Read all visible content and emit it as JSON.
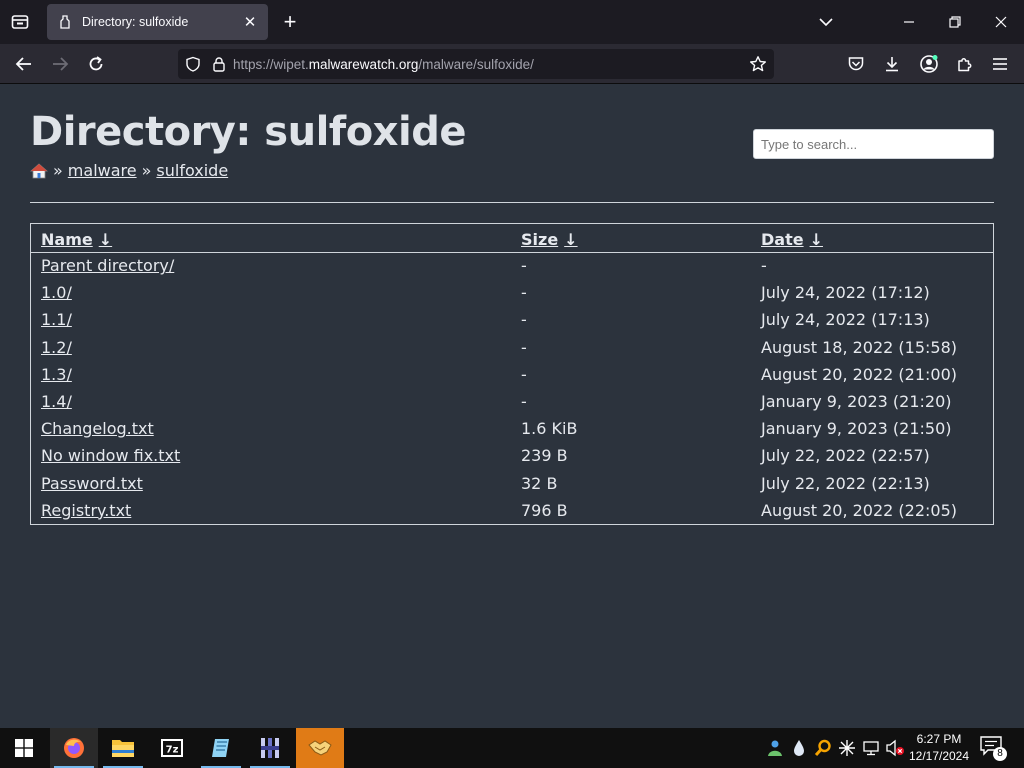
{
  "browser": {
    "tab_title": "Directory: sulfoxide",
    "url_prefix": "https://wipet.",
    "url_host": "malwarewatch.org",
    "url_path": "/malware/sulfoxide/"
  },
  "page": {
    "title": "Directory: sulfoxide",
    "breadcrumb": [
      "malware",
      "sulfoxide"
    ],
    "breadcrumb_sep": "»",
    "search_placeholder": "Type to search...",
    "columns": [
      {
        "label": "Name",
        "arrow": "↓"
      },
      {
        "label": "Size",
        "arrow": "↓"
      },
      {
        "label": "Date",
        "arrow": "↓"
      }
    ],
    "rows": [
      {
        "name": "Parent directory/",
        "size": "-",
        "date": "-"
      },
      {
        "name": "1.0/",
        "size": "-",
        "date": "July 24, 2022 (17:12)"
      },
      {
        "name": "1.1/",
        "size": "-",
        "date": "July 24, 2022 (17:13)"
      },
      {
        "name": "1.2/",
        "size": "-",
        "date": "August 18, 2022 (15:58)"
      },
      {
        "name": "1.3/",
        "size": "-",
        "date": "August 20, 2022 (21:00)"
      },
      {
        "name": "1.4/",
        "size": "-",
        "date": "January 9, 2023 (21:20)"
      },
      {
        "name": "Changelog.txt",
        "size": "1.6 KiB",
        "date": "January 9, 2023 (21:50)"
      },
      {
        "name": "No window fix.txt",
        "size": "239 B",
        "date": "July 22, 2022 (22:57)"
      },
      {
        "name": "Password.txt",
        "size": "32 B",
        "date": "July 22, 2022 (22:13)"
      },
      {
        "name": "Registry.txt",
        "size": "796 B",
        "date": "August 20, 2022 (22:05)"
      }
    ]
  },
  "taskbar": {
    "time": "6:27 PM",
    "date": "12/17/2024",
    "notification_count": "8",
    "apps": [
      "firefox-icon",
      "file-explorer-icon",
      "7zip-icon",
      "notepad-icon",
      "app-icon",
      "handshake-icon"
    ]
  },
  "colors": {
    "page_bg": "#2c333d",
    "chrome_bg": "#1c1b22",
    "taskbar_highlight": "#e07b16"
  }
}
